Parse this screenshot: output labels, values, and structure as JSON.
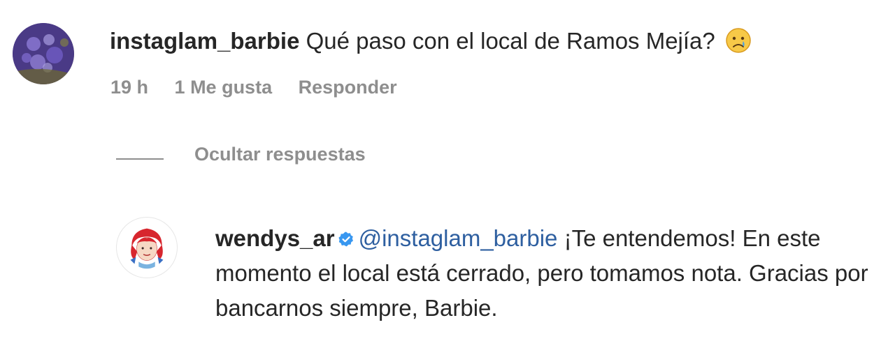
{
  "comment": {
    "username": "instaglam_barbie",
    "text": "Qué paso con el local de Ramos Mejía?",
    "emoji": "crying-face",
    "time": "19 h",
    "likes": "1 Me gusta",
    "reply_label": "Responder"
  },
  "replies_toggle": {
    "label": "Ocultar respuestas"
  },
  "reply": {
    "username": "wendys_ar",
    "verified": true,
    "mention": "@instaglam_barbie",
    "text": "¡Te entendemos! En este momento el local está cerrado, pero tomamos nota. Gracias por bancarnos siempre, Barbie."
  },
  "colors": {
    "text": "#262626",
    "muted": "#8e8e8e",
    "mention": "#2e5fa0",
    "verified": "#3897f0"
  }
}
